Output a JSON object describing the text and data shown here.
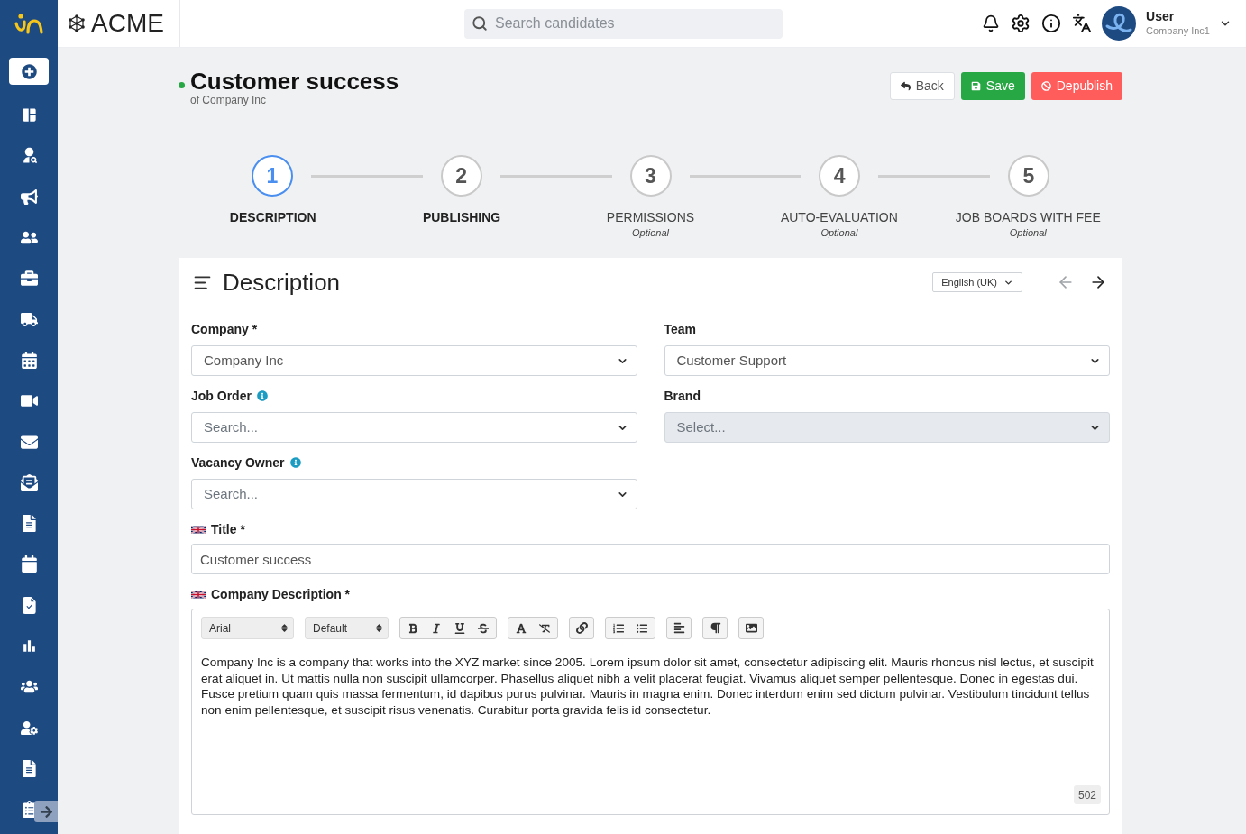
{
  "header": {
    "brand": "ACME",
    "search": {
      "placeholder": "Search candidates"
    },
    "user": {
      "name": "User",
      "company": "Company Inc1"
    }
  },
  "page": {
    "title": "Customer success",
    "subtitle": "of Company Inc",
    "published": true,
    "actions": [
      {
        "kind": "back",
        "label": "Back"
      },
      {
        "kind": "save",
        "label": "Save"
      },
      {
        "kind": "depublish",
        "label": "Depublish"
      }
    ]
  },
  "steps": [
    {
      "number": "1",
      "label": "DESCRIPTION",
      "selected": true
    },
    {
      "number": "2",
      "label": "PUBLISHING",
      "selected": false
    },
    {
      "number": "3",
      "label": "PERMISSIONS",
      "note": "Optional",
      "selected": false
    },
    {
      "number": "4",
      "label": "AUTO-EVALUATION",
      "note": "Optional",
      "selected": false
    },
    {
      "number": "5",
      "label": "JOB BOARDS WITH FEE",
      "note": "Optional",
      "selected": false
    }
  ],
  "section": {
    "title": "Description",
    "language": "English (UK)",
    "previous_disabled": true,
    "next_disabled": false,
    "fields": [
      {
        "kind": "select",
        "label": "Company *",
        "value": "Company Inc",
        "info": false,
        "flag": false,
        "disabled": false
      },
      {
        "kind": "select",
        "label": "Team",
        "value": "Customer Support",
        "info": false,
        "flag": false,
        "disabled": false
      },
      {
        "kind": "select",
        "label": "Job Order",
        "placeholder": "Search...",
        "info": true,
        "flag": false,
        "disabled": false
      },
      {
        "kind": "select",
        "label": "Brand",
        "placeholder": "Select...",
        "info": false,
        "flag": false,
        "disabled": true
      },
      {
        "kind": "select",
        "label": "Vacancy Owner",
        "placeholder": "Search...",
        "info": true,
        "flag": false,
        "disabled": false
      },
      {
        "kind": "text",
        "label": "Title *",
        "value": "Customer success",
        "info": false,
        "flag": true,
        "disabled": false
      },
      {
        "kind": "editor",
        "label": "Company Description *",
        "info": false,
        "flag": true,
        "disabled": false,
        "font": "Arial",
        "size": "Default",
        "text": "Company Inc is a company that works into the XYZ market since 2005. Lorem ipsum dolor sit amet, consectetur adipiscing elit. Mauris rhoncus nisl lectus, et suscipit erat aliquet in. Ut mattis nulla non suscipit ullamcorper. Phasellus aliquet nibh a velit placerat feugiat. Vivamus aliquet semper pellentesque. Donec in egestas dui. Fusce pretium quam quis massa fermentum, id dapibus purus pulvinar. Mauris in magna enim. Donec interdum enim sed dictum pulvinar. Vestibulum tincidunt tellus non enim pellentesque, et suscipit risus venenatis. Curabitur porta gravida felis id consectetur.",
        "count": "502"
      }
    ]
  }
}
